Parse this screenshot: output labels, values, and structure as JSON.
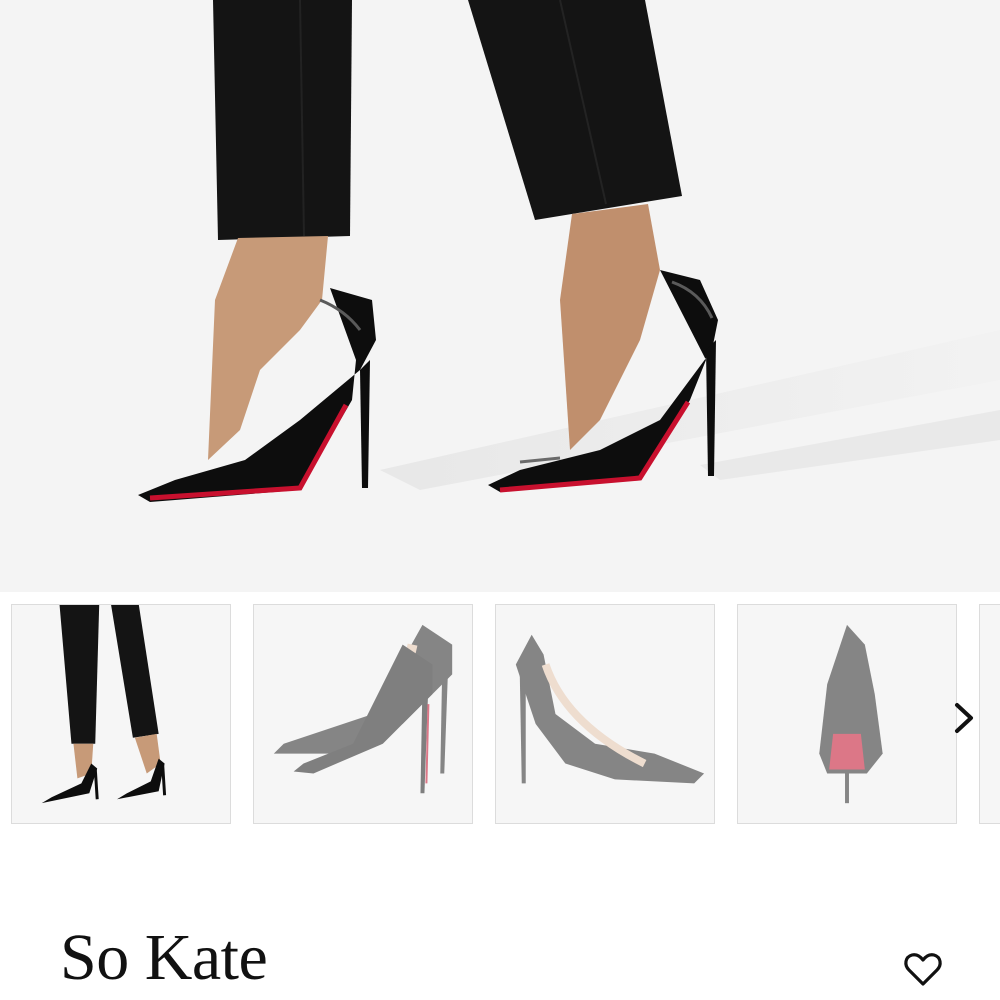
{
  "product": {
    "title": "So Kate"
  },
  "gallery": {
    "thumbnail_count": 4,
    "selected_index": 0
  },
  "icons": {
    "next": "chevron-right-icon",
    "wishlist": "heart-outline-icon"
  },
  "colors": {
    "sole_red": "#c8102e",
    "patent_black": "#0d0d0d",
    "trouser_black": "#141414",
    "skin": "#c79a78",
    "background": "#f4f4f4"
  }
}
